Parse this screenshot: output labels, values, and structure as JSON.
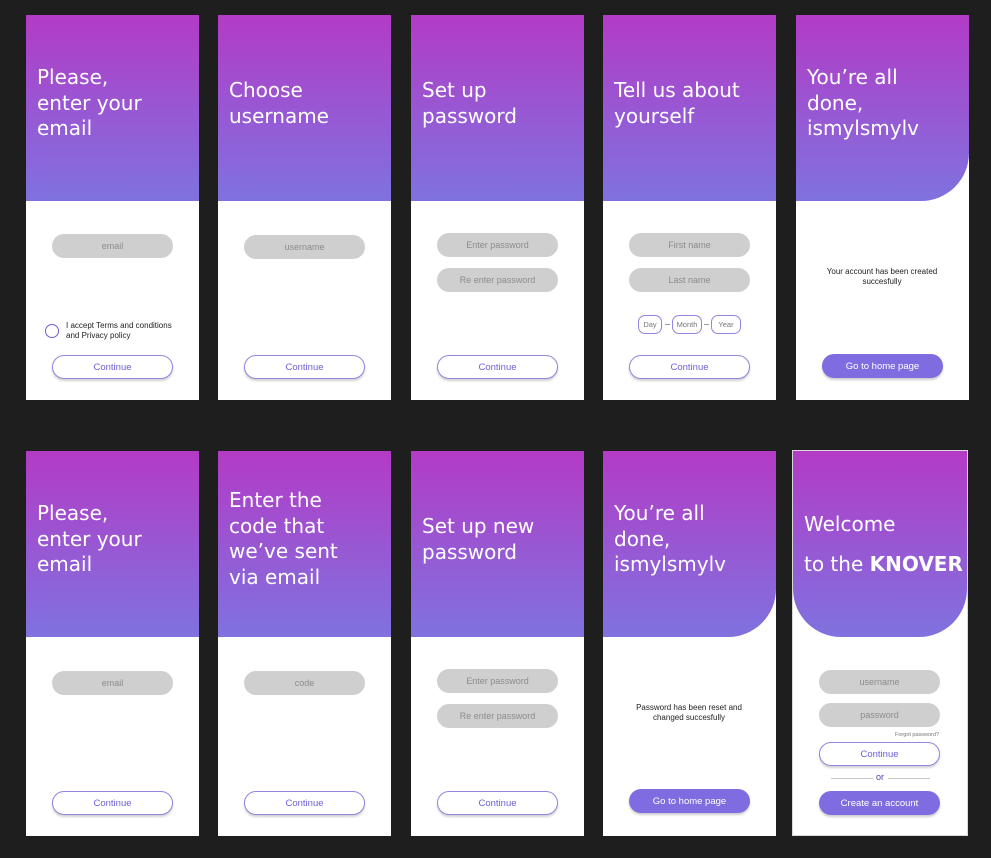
{
  "colors": {
    "background": "#1e1e1e",
    "gradient_top": "#b33bc6",
    "gradient_bottom": "#7f72df",
    "accent": "#7f6ce0",
    "input_fill": "#cfcfcf"
  },
  "screens": {
    "s1": {
      "title": "Please,\nenter your\nemail",
      "email_placeholder": "email",
      "terms_text": "I accept Terms and conditions\nand Privacy policy",
      "continue": "Continue"
    },
    "s2": {
      "title": "Choose\nusername",
      "username_placeholder": "username",
      "continue": "Continue"
    },
    "s3": {
      "title": "Set up\npassword",
      "password_placeholder": "Enter password",
      "reenter_placeholder": "Re enter password",
      "continue": "Continue"
    },
    "s4": {
      "title": "Tell us about\nyourself",
      "first_name": "First name",
      "last_name": "Last name",
      "day": "Day",
      "month": "Month",
      "year": "Year",
      "continue": "Continue"
    },
    "s5": {
      "title": "You’re all\ndone,\nismylsmylv",
      "message": "Your account has been created\nsuccesfully",
      "home_button": "Go to home page"
    },
    "s6": {
      "title": "Please,\nenter your\nemail",
      "email_placeholder": "email",
      "continue": "Continue"
    },
    "s7": {
      "title": "Enter the\ncode that\nwe’ve sent\nvia email",
      "code_placeholder": "code",
      "continue": "Continue"
    },
    "s8": {
      "title": "Set up new\npassword",
      "password_placeholder": "Enter password",
      "reenter_placeholder": "Re enter password",
      "continue": "Continue"
    },
    "s9": {
      "title": "You’re all\ndone,\nismylsmylv",
      "message": "Password has been reset and\nchanged succesfully",
      "home_button": "Go to home page"
    },
    "s10": {
      "welcome": "Welcome",
      "to_the": "to the",
      "brand": "KNOVER",
      "username_placeholder": "username",
      "password_placeholder": "password",
      "forgot": "Forgot password?",
      "continue": "Continue",
      "or": "or",
      "create_account": "Create an account"
    }
  }
}
